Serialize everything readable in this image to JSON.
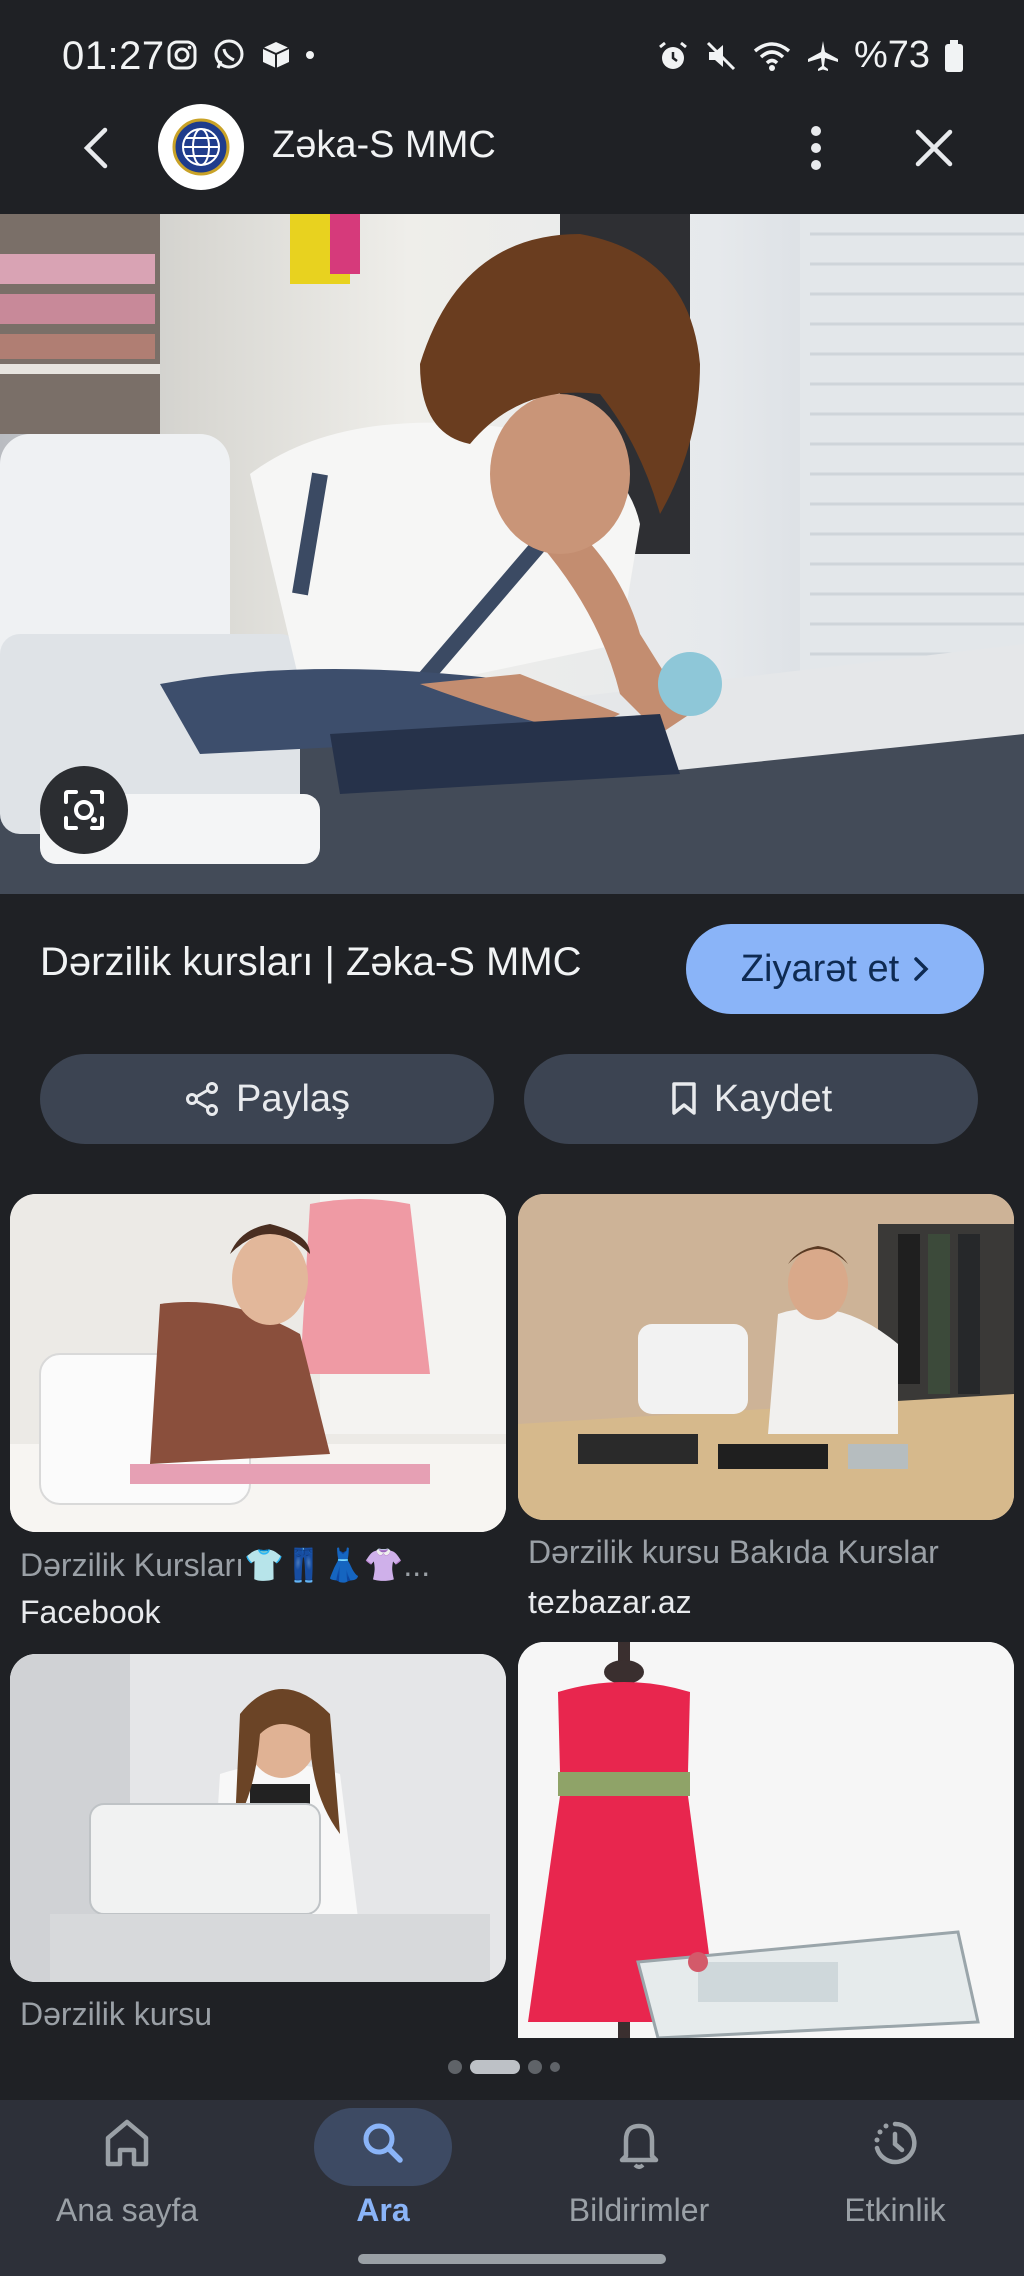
{
  "status_bar": {
    "time": "01:27",
    "battery": "%73",
    "left_icons": [
      "instagram-icon",
      "whatsapp-icon",
      "box-icon"
    ],
    "right_icons": [
      "alarm-icon",
      "mute-icon",
      "wifi-icon",
      "airplane-icon",
      "battery-icon"
    ]
  },
  "header": {
    "site_name": "Zəka-S MMC"
  },
  "result": {
    "title": "Dərzilik kursları | Zəka-S MMC",
    "visit_label": "Ziyarət et",
    "share_label": "Paylaş",
    "save_label": "Kaydet"
  },
  "related": [
    {
      "caption": "Dərzilik Kursları👕👖👗👚...",
      "source": "Facebook"
    },
    {
      "caption": "Dərzilik kursu Bakıda Kurslar",
      "source": "tezbazar.az"
    },
    {
      "caption": "Dərzilik kursu",
      "source": ""
    },
    {
      "caption": "",
      "source": ""
    }
  ],
  "bottom_nav": {
    "items": [
      {
        "label": "Ana sayfa",
        "icon": "home-icon"
      },
      {
        "label": "Ara",
        "icon": "search-icon"
      },
      {
        "label": "Bildirimler",
        "icon": "bell-icon"
      },
      {
        "label": "Etkinlik",
        "icon": "activity-icon"
      }
    ],
    "active_index": 1
  },
  "colors": {
    "background": "#1f2125",
    "accent": "#8ab4f8",
    "active_nav": "#8ab4f8",
    "button_bg": "#3c4452"
  }
}
